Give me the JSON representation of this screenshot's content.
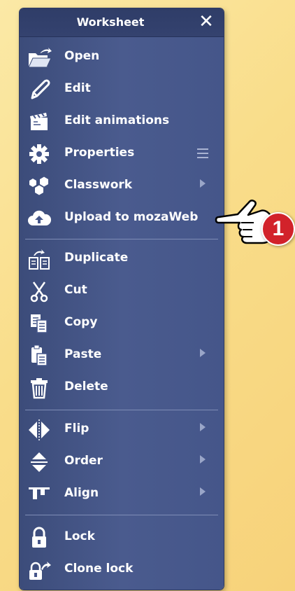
{
  "panel": {
    "title": "Worksheet",
    "close_icon": "close-icon"
  },
  "items": [
    {
      "label": "Open",
      "icon": "open-folder-icon"
    },
    {
      "label": "Edit",
      "icon": "pencil-icon"
    },
    {
      "label": "Edit animations",
      "icon": "clapperboard-icon"
    },
    {
      "label": "Properties",
      "icon": "gear-icon",
      "extra": "menu-lines-icon"
    },
    {
      "label": "Classwork",
      "icon": "hexagons-icon",
      "submenu": true
    },
    {
      "label": "Upload to mozaWeb",
      "icon": "cloud-upload-icon"
    },
    {
      "label": "Duplicate",
      "icon": "duplicate-icon"
    },
    {
      "label": "Cut",
      "icon": "scissors-icon"
    },
    {
      "label": "Copy",
      "icon": "copy-icon"
    },
    {
      "label": "Paste",
      "icon": "paste-icon",
      "submenu": true
    },
    {
      "label": "Delete",
      "icon": "trash-icon"
    },
    {
      "label": "Flip",
      "icon": "flip-icon",
      "submenu": true
    },
    {
      "label": "Order",
      "icon": "order-icon",
      "submenu": true
    },
    {
      "label": "Align",
      "icon": "align-icon",
      "submenu": true
    },
    {
      "label": "Lock",
      "icon": "lock-icon"
    },
    {
      "label": "Clone lock",
      "icon": "clone-lock-icon"
    }
  ],
  "callout": {
    "number": "1",
    "icon": "pointing-hand-icon",
    "badge_color": "#d2222a"
  },
  "colors": {
    "panel_bg": "#45568a",
    "text": "#ffffff",
    "background": "#f9dd8a"
  }
}
